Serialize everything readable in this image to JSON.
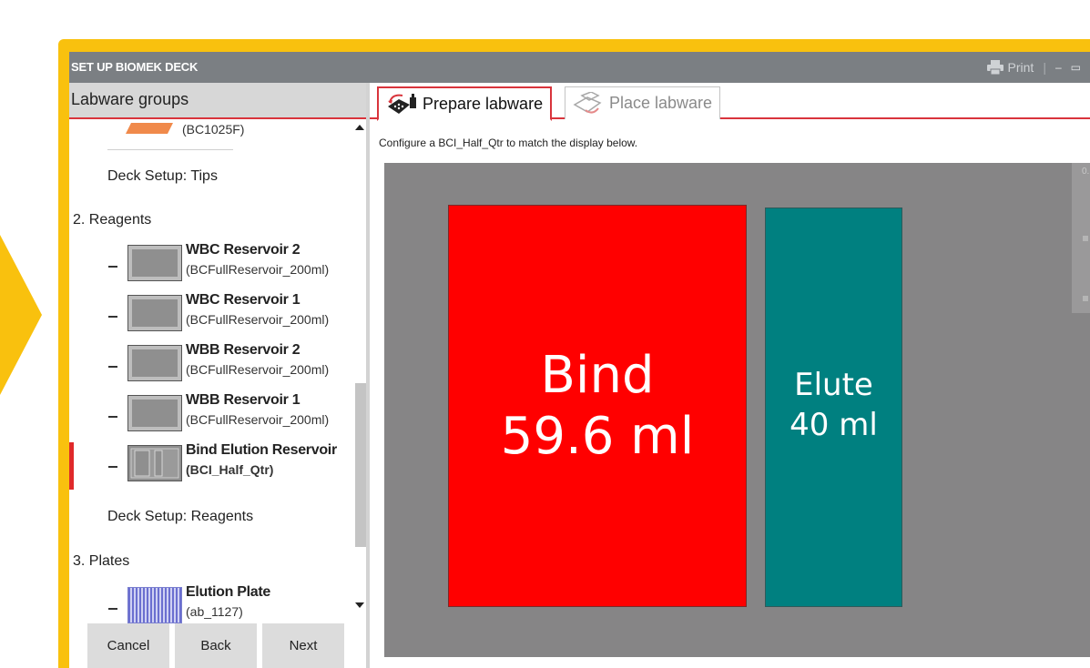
{
  "window": {
    "title": "SET UP BIOMEK DECK",
    "print_label": "Print",
    "minimize_glyph": "–",
    "maximize_glyph": "▭"
  },
  "sidebar": {
    "header": "Labware groups",
    "top_partial_item": {
      "sub": "(BC1025F)"
    },
    "sections": [
      {
        "label": "Deck Setup: Tips"
      },
      {
        "label": "2. Reagents"
      },
      {
        "label": "Deck Setup: Reagents"
      },
      {
        "label": "3. Plates"
      }
    ],
    "items": [
      {
        "name": "WBC Reservoir 2",
        "sub": "(BCFullReservoir_200ml)"
      },
      {
        "name": "WBC Reservoir 1",
        "sub": "(BCFullReservoir_200ml)"
      },
      {
        "name": "WBB Reservoir 2",
        "sub": "(BCFullReservoir_200ml)"
      },
      {
        "name": "WBB Reservoir 1",
        "sub": "(BCFullReservoir_200ml)"
      },
      {
        "name": "Bind Elution Reservoir",
        "sub": "(BCI_Half_Qtr)",
        "selected": true
      },
      {
        "name": "Elution Plate",
        "sub": "(ab_1127)"
      }
    ],
    "footer": {
      "cancel": "Cancel",
      "back": "Back",
      "next": "Next"
    }
  },
  "main": {
    "tabs": [
      {
        "label": "Prepare labware",
        "active": true,
        "icon": "prepare-labware-icon"
      },
      {
        "label": "Place labware",
        "active": false,
        "icon": "place-labware-icon"
      }
    ],
    "instruction": "Configure a BCI_Half_Qtr to match the display below.",
    "rail_text": "0.",
    "wells": [
      {
        "name": "Bind",
        "volume": "59.6 ml",
        "color": "#ff0000"
      },
      {
        "name": "Elute",
        "volume": "40 ml",
        "color": "#008080"
      }
    ]
  },
  "colors": {
    "frame": "#f9c10e",
    "titlebar": "#7b7f83",
    "accent": "#d9343c",
    "canvas": "#868586"
  }
}
